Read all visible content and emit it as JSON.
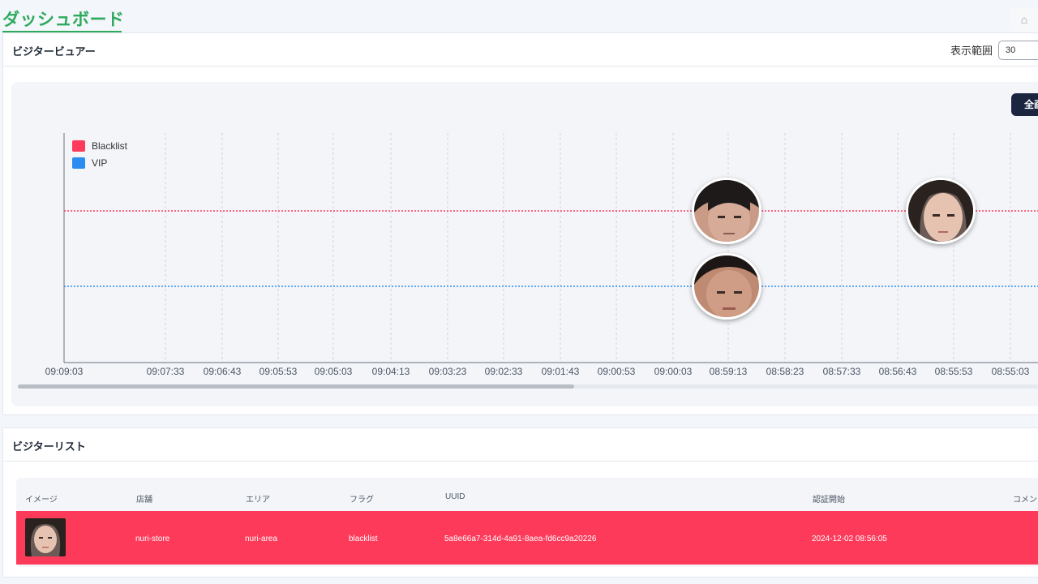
{
  "header": {
    "title": "ダッシュボード",
    "home_icon": "home-icon"
  },
  "viewer": {
    "title": "ビジタービュアー",
    "range_label": "表示範囲",
    "range_value": "30",
    "full_button": "全画"
  },
  "chart_data": {
    "type": "scatter",
    "legend": [
      {
        "name": "Blacklist",
        "color": "#ff3b5c"
      },
      {
        "name": "VIP",
        "color": "#2d8cf0"
      }
    ],
    "x_ticks": [
      "09:09:03",
      "09:07:33",
      "09:06:43",
      "09:05:53",
      "09:05:03",
      "09:04:13",
      "09:03:23",
      "09:02:33",
      "09:01:43",
      "09:00:53",
      "09:00:03",
      "08:59:13",
      "08:58:23",
      "08:57:33",
      "08:56:43",
      "08:55:53",
      "08:55:03"
    ],
    "series": [
      {
        "name": "Blacklist",
        "points": [
          "08:59:13",
          "08:55:53"
        ]
      },
      {
        "name": "VIP",
        "points": [
          "08:59:13"
        ]
      }
    ],
    "grid": true,
    "legend_position": "top-left"
  },
  "list": {
    "title": "ビジターリスト",
    "columns": [
      "イメージ",
      "店舗",
      "エリア",
      "フラグ",
      "UUID",
      "認証開始",
      "コメン"
    ],
    "rows": [
      {
        "store": "nuri-store",
        "area": "nuri-area",
        "flag": "blacklist",
        "uuid": "5a8e66a7-314d-4a91-8aea-fd6cc9a20226",
        "auth_start": "2024-12-02 08:56:05",
        "row_color": "#fe3a5a"
      }
    ]
  }
}
